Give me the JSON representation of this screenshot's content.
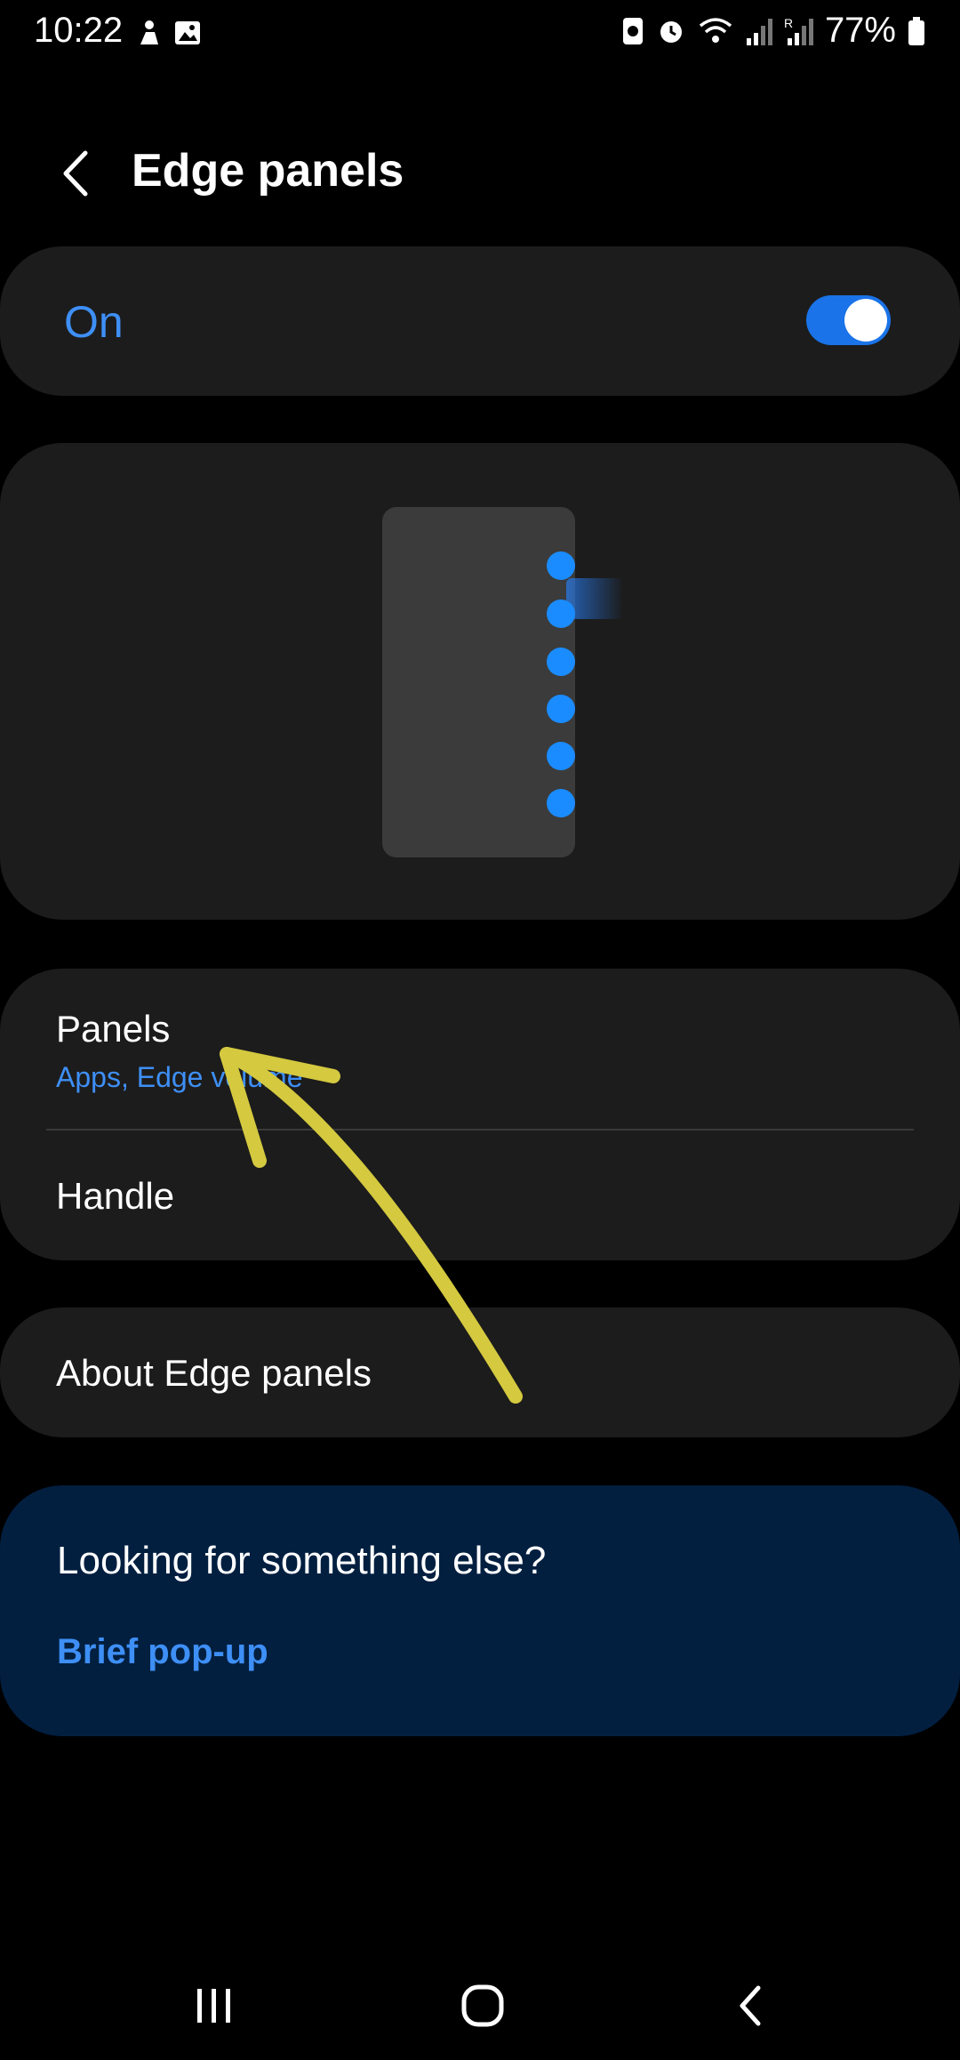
{
  "status_bar": {
    "time": "10:22",
    "battery": "77%",
    "icons_left": [
      "notification-figure-icon",
      "image-icon"
    ],
    "icons_right": [
      "data-saver-icon",
      "alarm-icon",
      "wifi-icon",
      "signal-icon",
      "roaming-signal-icon",
      "battery-icon"
    ]
  },
  "header": {
    "title": "Edge panels"
  },
  "master_switch": {
    "label": "On",
    "state": "on"
  },
  "settings": {
    "panels_title": "Panels",
    "panels_subtitle": "Apps, Edge volume",
    "handle_title": "Handle"
  },
  "about": {
    "title": "About Edge panels"
  },
  "suggestions": {
    "title": "Looking for something else?",
    "link": "Brief pop-up"
  },
  "colors": {
    "accent": "#3e8ff6",
    "toggle_on": "#1a73e8",
    "card_bg": "#1c1c1c",
    "suggest_bg": "#021f40",
    "annotation": "#d4c93f"
  }
}
